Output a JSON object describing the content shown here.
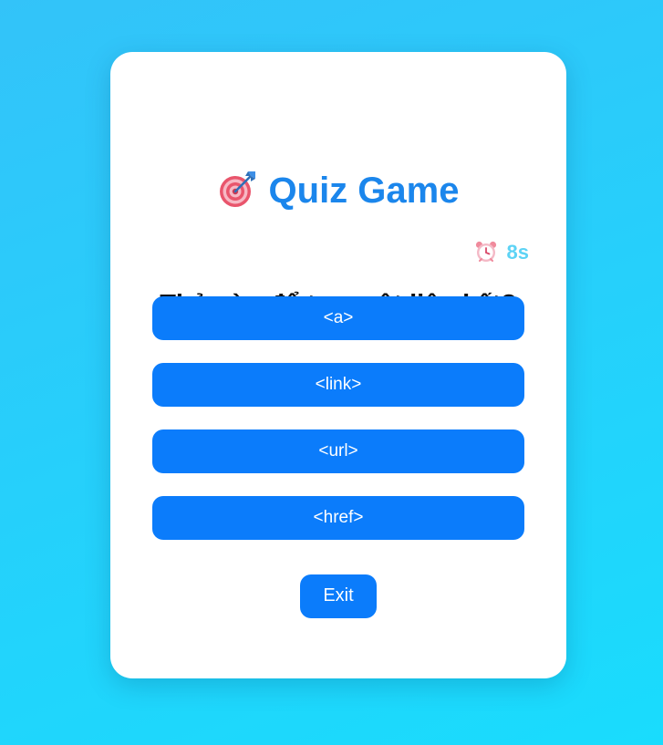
{
  "header": {
    "title": "Quiz Game",
    "title_icon": "dart-target-icon"
  },
  "timer": {
    "value": "8s",
    "icon": "alarm-clock-icon"
  },
  "question": {
    "text": "Thẻ nào để tạo một liên kết?"
  },
  "options": [
    {
      "label": "<a>"
    },
    {
      "label": "<link>"
    },
    {
      "label": "<url>"
    },
    {
      "label": "<href>"
    }
  ],
  "actions": {
    "exit_label": "Exit"
  },
  "colors": {
    "background_start": "#33c3f9",
    "background_end": "#19dcfd",
    "title": "#1b86ec",
    "timer": "#5dd3f5",
    "button": "#0b7cfb",
    "card": "#ffffff"
  }
}
